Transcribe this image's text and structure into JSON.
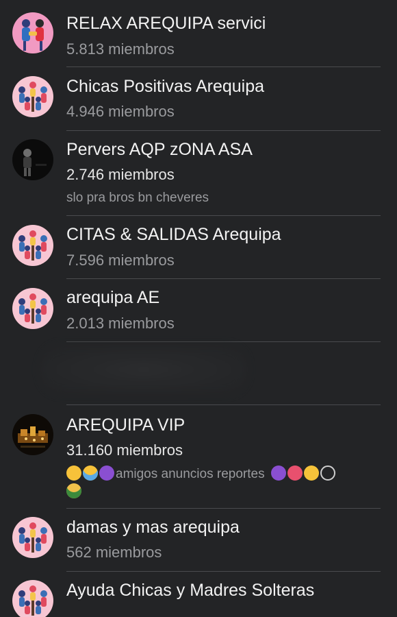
{
  "groups": [
    {
      "title": "RELAX AREQUIPA servici",
      "members": "5.813 miembros",
      "avatar": "couple-illustration-avatar"
    },
    {
      "title": "Chicas Positivas Arequipa",
      "members": "4.946 miembros",
      "avatar": "group-illustration-avatar"
    },
    {
      "title": "Pervers AQP zONA  ASA",
      "members": "2.746 miembros",
      "description": "slo pra bros bn cheveres",
      "avatar": "dark-photo-avatar"
    },
    {
      "title": "CITAS & SALIDAS Arequipa",
      "members": "7.596 miembros",
      "avatar": "group-illustration-avatar"
    },
    {
      "title": "arequipa AE",
      "members": "2.013 miembros",
      "avatar": "group-illustration-avatar"
    },
    {
      "title": "AREQUIPA VIP",
      "members": "31.160 miembros",
      "description": "amigos anuncios reportes",
      "avatar": "city-night-avatar"
    },
    {
      "title": "damas y mas arequipa",
      "members": "562 miembros",
      "avatar": "group-illustration-avatar"
    },
    {
      "title": "Ayuda Chicas y Madres Solteras",
      "members": "",
      "avatar": "group-illustration-avatar"
    }
  ],
  "emoji_names": [
    "heart-eyes-cat-emoji",
    "screaming-face-emoji",
    "smiling-devil-emoji",
    "smiling-devil-emoji",
    "tulip-emoji",
    "sun-face-emoji",
    "phone-emoji",
    "two-men-emoji"
  ],
  "colors": {
    "background": "#232426",
    "title": "#f2f2f2",
    "secondary": "#9a9b9e",
    "divider": "#4a4b4e",
    "avatar_pink": "#f7c6d3"
  }
}
